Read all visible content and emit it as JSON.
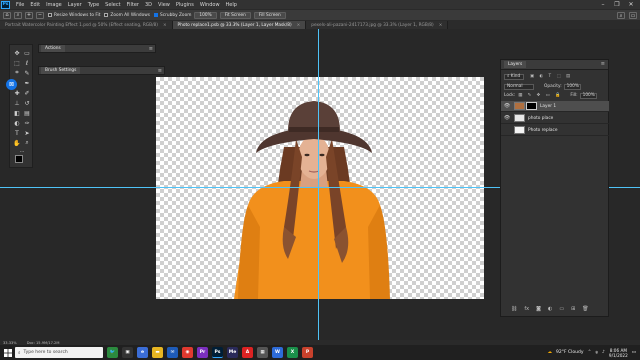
{
  "menubar": {
    "logo": "Ps",
    "items": [
      "File",
      "Edit",
      "Image",
      "Layer",
      "Type",
      "Select",
      "Filter",
      "3D",
      "View",
      "Plugins",
      "Window",
      "Help"
    ]
  },
  "options": {
    "resize_windows": "Resize Windows to Fit",
    "zoom_all": "Zoom All Windows",
    "scrubby_zoom": "Scrubby Zoom",
    "zoom_100": "100%",
    "fit_screen": "Fit Screen",
    "fill_screen": "Fill Screen"
  },
  "tabs": [
    {
      "label": "Portrait Watercolor Painting Effect 1.psd @ 50% (Effect seating, RGB/8)"
    },
    {
      "label": "Photo replace1.psb @ 33.3% (Layer 1, Layer Mask/8)"
    },
    {
      "label": "pexels-ali-pazani-2417173.jpg @ 33.3% (Layer 1, RGB/8)"
    }
  ],
  "panels": {
    "actions": "Actions",
    "brush_settings": "Brush Settings"
  },
  "layers": {
    "title": "Layers",
    "kind": "Kind",
    "blend_mode": "Normal",
    "opacity_label": "Opacity:",
    "opacity_value": "100%",
    "lock_label": "Lock:",
    "fill_label": "Fill:",
    "fill_value": "100%",
    "items": [
      {
        "name": "Layer 1"
      },
      {
        "name": "photo place"
      },
      {
        "name": "Photo replace"
      }
    ]
  },
  "status": {
    "zoom": "33.33%",
    "doc": "Doc: 15.9M/17.2M"
  },
  "taskbar": {
    "search_placeholder": "Type here to search",
    "weather": "92°F Cloudy",
    "time": "8:06 AM",
    "date": "9/1/2022"
  },
  "colors": {
    "accent": "#1473e6",
    "guide": "#4fc3f7",
    "sweater": "#f2901c",
    "hat": "#5a4038"
  }
}
